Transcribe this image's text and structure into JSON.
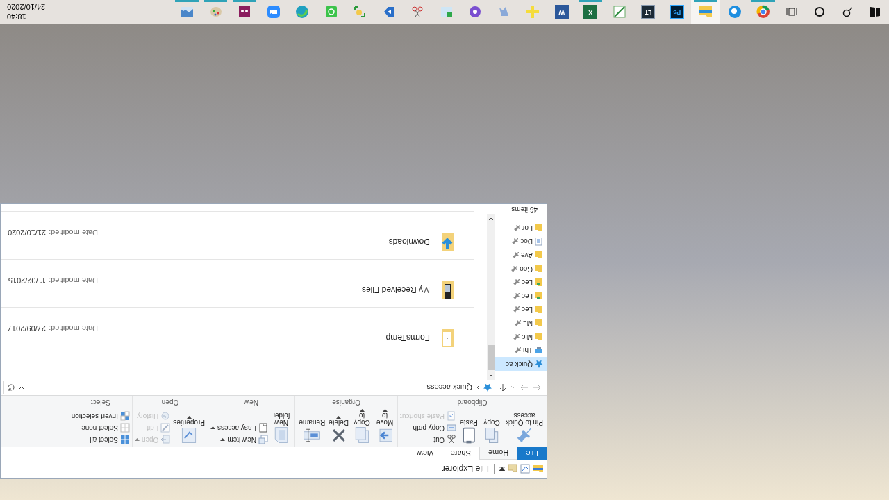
{
  "explorer": {
    "title": "File Explorer",
    "tabs": [
      {
        "label": "File",
        "kind": "file",
        "selected": false
      },
      {
        "label": "Home",
        "kind": "tab",
        "selected": true
      },
      {
        "label": "Share",
        "kind": "tab",
        "selected": false
      },
      {
        "label": "View",
        "kind": "tab",
        "selected": false
      }
    ],
    "ribbon": [
      {
        "label": "Clipboard",
        "items": [
          {
            "kind": "pin",
            "label": "Pin to Quick access",
            "disabled": false
          },
          {
            "kind": "copy",
            "label": "Copy",
            "disabled": false
          },
          {
            "kind": "paste",
            "label": "Paste",
            "disabled": false
          },
          {
            "kind": "cut",
            "label": "Cut",
            "disabled": false
          },
          {
            "kind": "copy_path",
            "label": "Copy path",
            "disabled": false
          },
          {
            "kind": "paste_shortcut",
            "label": "Paste shortcut",
            "disabled": true
          }
        ]
      },
      {
        "label": "Organise",
        "items": [
          {
            "kind": "move",
            "label": "Move to",
            "disabled": false
          },
          {
            "kind": "copy_to",
            "label": "Copy to",
            "disabled": false
          },
          {
            "kind": "delete",
            "label": "Delete",
            "disabled": false
          },
          {
            "kind": "rename",
            "label": "Rename",
            "disabled": false
          }
        ]
      },
      {
        "label": "New",
        "items": [
          {
            "kind": "new_folder",
            "label": "New folder",
            "disabled": false
          },
          {
            "kind": "new_item",
            "label": "New item",
            "disabled": false
          },
          {
            "kind": "easy_access",
            "label": "Easy access",
            "disabled": false
          }
        ]
      },
      {
        "label": "Open",
        "items": [
          {
            "kind": "properties",
            "label": "Properties",
            "disabled": false
          },
          {
            "kind": "open",
            "label": "Open",
            "disabled": true
          },
          {
            "kind": "edit",
            "label": "Edit",
            "disabled": true
          },
          {
            "kind": "history",
            "label": "History",
            "disabled": true
          }
        ]
      },
      {
        "label": "Select",
        "items": [
          {
            "kind": "select_all",
            "label": "Select all",
            "disabled": false
          },
          {
            "kind": "select_none",
            "label": "Select none",
            "disabled": false
          },
          {
            "kind": "invert",
            "label": "Invert selection",
            "disabled": false
          }
        ]
      }
    ],
    "address": {
      "path": "Quick access"
    },
    "nav": [
      {
        "label": "Quick ac",
        "kind": "star",
        "pinned": false,
        "selected": true
      },
      {
        "label": "Thi",
        "kind": "pc",
        "pinned": true,
        "selected": false
      },
      {
        "label": "Mic",
        "kind": "folder",
        "pinned": true,
        "selected": false
      },
      {
        "label": "ML",
        "kind": "folder",
        "pinned": true,
        "selected": false
      },
      {
        "label": "Lec",
        "kind": "folder",
        "pinned": true,
        "selected": false
      },
      {
        "label": "Lec",
        "kind": "green_folder",
        "pinned": true,
        "selected": false
      },
      {
        "label": "Lec",
        "kind": "green_folder",
        "pinned": true,
        "selected": false
      },
      {
        "label": "Goo",
        "kind": "folder",
        "pinned": true,
        "selected": false
      },
      {
        "label": "Ave",
        "kind": "folder",
        "pinned": true,
        "selected": false
      },
      {
        "label": "Doc",
        "kind": "doc",
        "pinned": true,
        "selected": false
      },
      {
        "label": "For",
        "kind": "folder",
        "pinned": true,
        "selected": false
      }
    ],
    "files": [
      {
        "name": "FormsTemp",
        "kind": "doc_folder",
        "date_label": "Date modified:",
        "date": "27/09/2017"
      },
      {
        "name": "My Received Files",
        "kind": "device_folder",
        "date_label": "Date modified:",
        "date": "11/02/2015"
      },
      {
        "name": "Downloads",
        "kind": "download_folder",
        "date_label": "Date modified:",
        "date": "21/10/2020"
      }
    ],
    "status": "46 items"
  },
  "taskbar": {
    "buttons": [
      {
        "kind": "start"
      },
      {
        "kind": "search"
      },
      {
        "kind": "cortana"
      },
      {
        "kind": "task_view"
      }
    ],
    "apps": [
      {
        "kind": "chrome",
        "running": true,
        "selected": false
      },
      {
        "kind": "edge_dev",
        "running": false,
        "selected": false
      },
      {
        "kind": "explorer",
        "running": true,
        "selected": true
      },
      {
        "kind": "ps",
        "glyph": "Ps",
        "running": false,
        "selected": false
      },
      {
        "kind": "lt",
        "glyph": "LT",
        "running": false,
        "selected": false
      },
      {
        "kind": "green_draw",
        "running": false,
        "selected": false
      },
      {
        "kind": "excel",
        "glyph": "X",
        "running": true,
        "selected": false
      },
      {
        "kind": "word",
        "glyph": "W",
        "running": false,
        "selected": false
      },
      {
        "kind": "ruler",
        "running": false,
        "selected": false
      },
      {
        "kind": "arrow",
        "running": false,
        "selected": false
      },
      {
        "kind": "purple",
        "running": false,
        "selected": false
      },
      {
        "kind": "green_table",
        "running": false,
        "selected": false
      },
      {
        "kind": "snip",
        "running": false,
        "selected": false
      },
      {
        "kind": "blue_d",
        "running": false,
        "selected": false
      },
      {
        "kind": "puzzle",
        "running": false,
        "selected": false
      },
      {
        "kind": "green",
        "running": false,
        "selected": false
      },
      {
        "kind": "edge",
        "running": false,
        "selected": false
      },
      {
        "kind": "zoom",
        "running": false,
        "selected": false
      },
      {
        "kind": "video",
        "running": true,
        "selected": false
      },
      {
        "kind": "paint",
        "running": true,
        "selected": false
      },
      {
        "kind": "photos",
        "running": true,
        "selected": false
      }
    ],
    "clock": {
      "time": "18:40",
      "date": "24/10/2020"
    }
  }
}
